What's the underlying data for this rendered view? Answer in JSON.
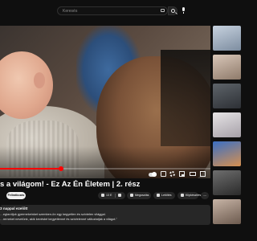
{
  "search": {
    "placeholder": "Keresés"
  },
  "video": {
    "title": "s a világom! - Ez Az Én Életem | 2. rész",
    "progress_fraction": 0.29
  },
  "actions": {
    "subscribe_label": "Feliratkozás",
    "like_count": "13 E",
    "share_label": "Megosztás",
    "download_label": "Letöltés",
    "clip_label": "Klipkészítés",
    "more_label": "…"
  },
  "description": {
    "title": "3 nappal ezelőtt",
    "line1": "…egtanítjuk gyermekeinket szemben-ön egy kegyetlen és szívtelen világgal.",
    "line2": "…remeket nevelünk, akik kevésbé kegyetlenné és szívtelenné változtatják a világot.\""
  },
  "sidebar": {
    "thumbnails": [
      {
        "name": "thumb-1",
        "colors": [
          "#c7d2df",
          "#7d8da0"
        ]
      },
      {
        "name": "thumb-2",
        "colors": [
          "#d9c7b9",
          "#8e7a6a"
        ]
      },
      {
        "name": "thumb-3",
        "colors": [
          "#5e646a",
          "#2d3035"
        ]
      },
      {
        "name": "thumb-4",
        "colors": [
          "#e6e4e6",
          "#a6a0a8"
        ]
      },
      {
        "name": "thumb-5",
        "colors": [
          "#3a6fc4",
          "#d69050"
        ]
      },
      {
        "name": "thumb-6",
        "colors": [
          "#6e6e6e",
          "#2a2a2a"
        ]
      },
      {
        "name": "thumb-7",
        "colors": [
          "#c7b4a6",
          "#6c5a4e"
        ]
      }
    ]
  },
  "colors": {
    "progress": "#ff0000",
    "background": "#0f0f0f"
  }
}
